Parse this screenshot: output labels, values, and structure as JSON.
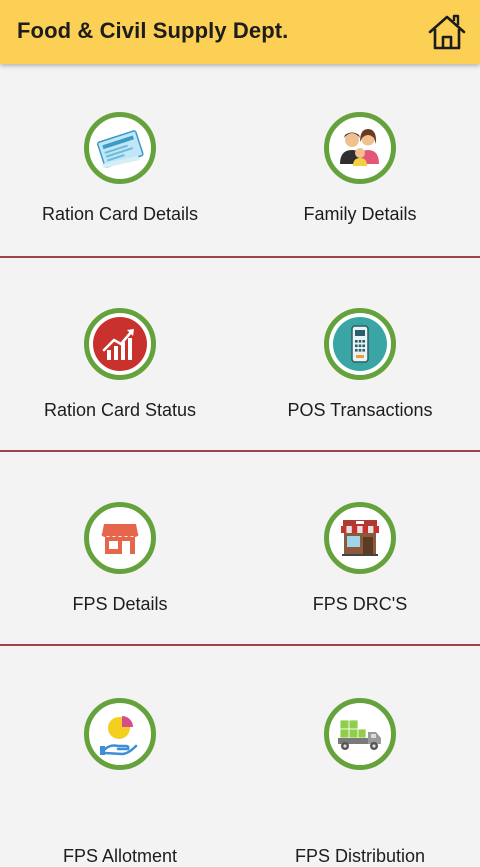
{
  "app_bar": {
    "title": "Food & Civil Supply Dept.",
    "home_icon": "home-icon"
  },
  "colors": {
    "app_bar_bg": "#fcd055",
    "ring": "#66a23b",
    "divider": "#a0424a",
    "background": "#f3f3f3"
  },
  "menu": [
    {
      "label": "Ration Card Details",
      "icon": "ration-card-icon"
    },
    {
      "label": "Family Details",
      "icon": "family-icon"
    },
    {
      "label": "Ration Card Status",
      "icon": "growth-chart-icon"
    },
    {
      "label": "POS Transactions",
      "icon": "pos-terminal-icon"
    },
    {
      "label": "FPS Details",
      "icon": "shop-icon"
    },
    {
      "label": "FPS DRC'S",
      "icon": "storefront-icon"
    },
    {
      "label": "FPS Allotment",
      "icon": "pie-chart-hand-icon"
    },
    {
      "label": "FPS Distribution",
      "icon": "delivery-truck-icon"
    }
  ]
}
